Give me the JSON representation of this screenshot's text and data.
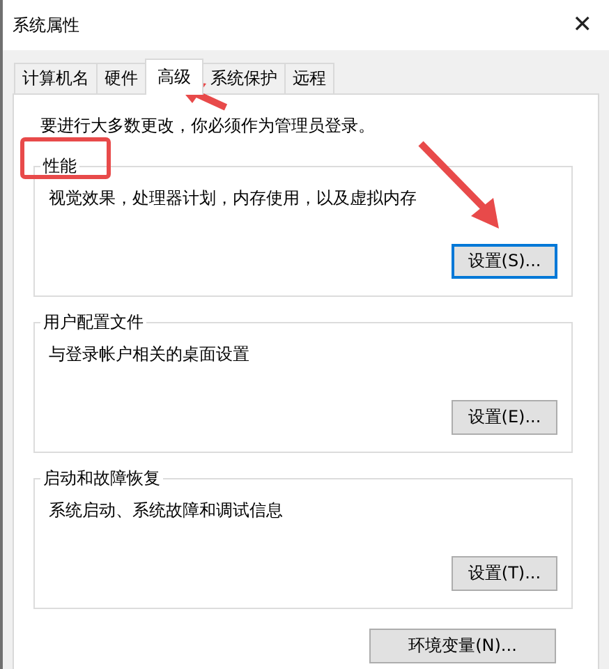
{
  "window": {
    "title": "系统属性",
    "close": "✕"
  },
  "tabs": [
    {
      "label": "计算机名",
      "selected": false
    },
    {
      "label": "硬件",
      "selected": false
    },
    {
      "label": "高级",
      "selected": true
    },
    {
      "label": "系统保护",
      "selected": false
    },
    {
      "label": "远程",
      "selected": false
    }
  ],
  "notice": "要进行大多数更改，你必须作为管理员登录。",
  "groups": [
    {
      "title": "性能",
      "description": "视觉效果，处理器计划，内存使用，以及虚拟内存",
      "button": "设置(S)...",
      "focused": true
    },
    {
      "title": "用户配置文件",
      "description": "与登录帐户相关的桌面设置",
      "button": "设置(E)...",
      "focused": false
    },
    {
      "title": "启动和故障恢复",
      "description": "系统启动、系统故障和调试信息",
      "button": "设置(T)...",
      "focused": false
    }
  ],
  "environment_button": "环境变量(N)..."
}
